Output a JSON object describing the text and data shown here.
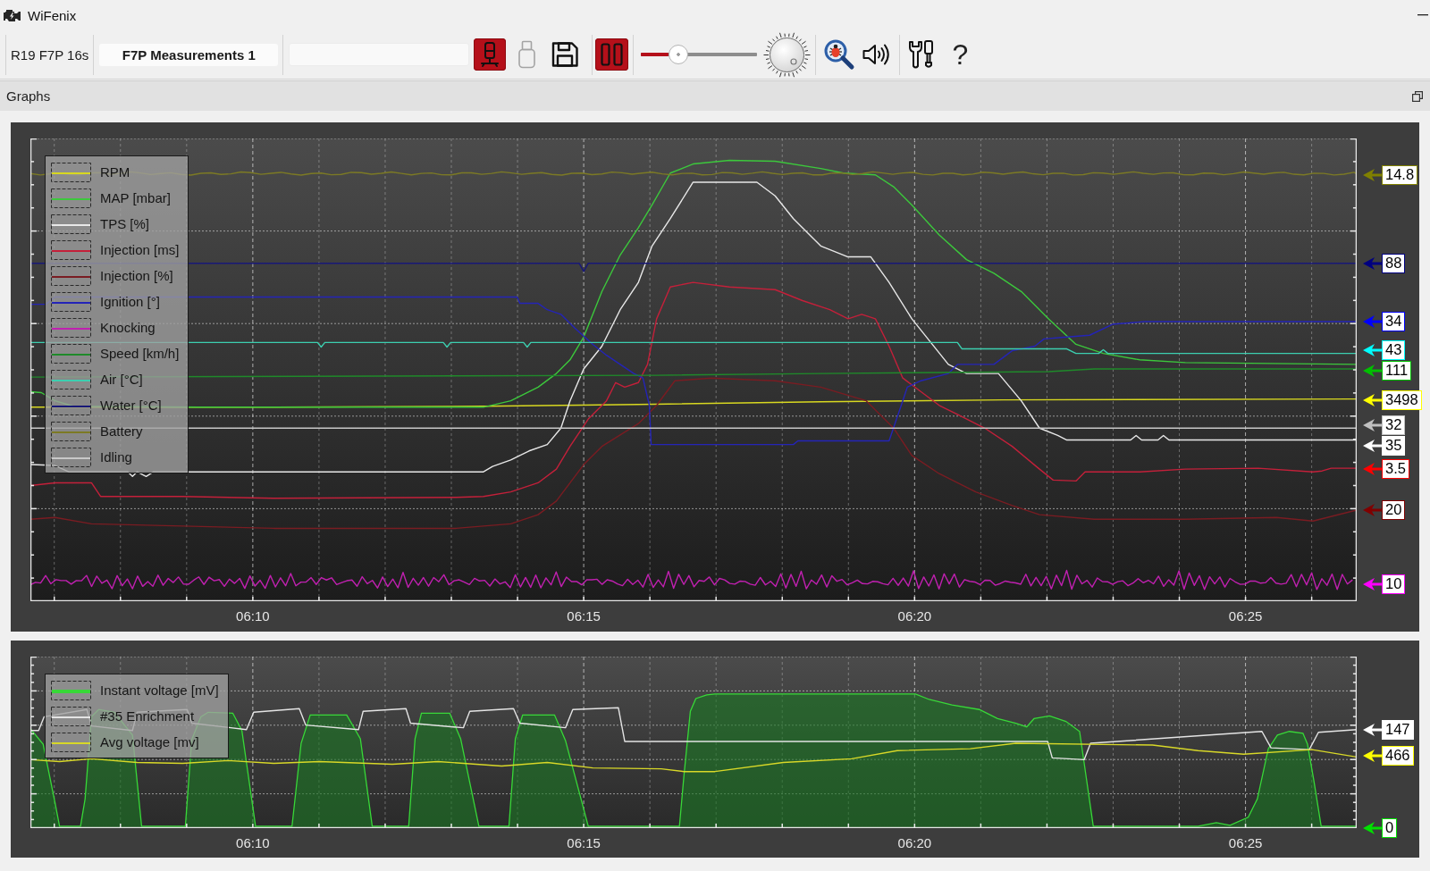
{
  "window": {
    "title": "WiFenix"
  },
  "toolbar": {
    "session_info": "R19 F7P 16s",
    "measurement_name": "F7P Measurements 1",
    "record_button": {
      "on": true
    },
    "usb_button": {
      "disabled": true
    },
    "save_button": {
      "disabled": false
    },
    "pause_button": {
      "on": true
    },
    "speed_slider": {
      "level": 0.32
    },
    "help_button": "?"
  },
  "panel": {
    "title": "Graphs"
  },
  "graphs": [
    {
      "legend": [
        {
          "label": "RPM",
          "color": "#d8d820"
        },
        {
          "label": "MAP [mbar]",
          "color": "#3cc83c"
        },
        {
          "label": "TPS [%]",
          "color": "#e8e8e8"
        },
        {
          "label": "Injection [ms]",
          "color": "#c4203a"
        },
        {
          "label": "Injection [%]",
          "color": "#7a1c22"
        },
        {
          "label": "Ignition [°]",
          "color": "#2424b8"
        },
        {
          "label": "Knocking",
          "color": "#c020b0"
        },
        {
          "label": "Speed [km/h]",
          "color": "#1f8a2a"
        },
        {
          "label": "Air [°C]",
          "color": "#3ccfb0"
        },
        {
          "label": "Water [°C]",
          "color": "#181878"
        },
        {
          "label": "Battery",
          "color": "#7c7a24"
        },
        {
          "label": "Idling",
          "color": "#c8c8c8"
        }
      ],
      "value_markers": [
        {
          "value": "14.8",
          "color": "#808000"
        },
        {
          "value": "88",
          "color": "#000080"
        },
        {
          "value": "34",
          "color": "#0000ff"
        },
        {
          "value": "43",
          "color": "#00ffff"
        },
        {
          "value": "111",
          "color": "#00c000"
        },
        {
          "value": "3498",
          "color": "#ffff00"
        },
        {
          "value": "32",
          "color": "#c0c0c0"
        },
        {
          "value": "35",
          "color": "#ffffff"
        },
        {
          "value": "3.5",
          "color": "#ff0000"
        },
        {
          "value": "20",
          "color": "#800000"
        },
        {
          "value": "10",
          "color": "#ff00ff"
        }
      ],
      "time_labels": [
        "06:10",
        "06:15",
        "06:20",
        "06:25"
      ]
    },
    {
      "legend": [
        {
          "label": "Instant voltage [mV]",
          "color": "#38d838",
          "kind": "area"
        },
        {
          "label": "#35 Enrichment",
          "color": "#e4e4e4",
          "kind": "line"
        },
        {
          "label": "Avg voltage [mv]",
          "color": "#d8d828",
          "kind": "line"
        }
      ],
      "value_markers": [
        {
          "value": "147",
          "color": "#ffffff"
        },
        {
          "value": "466",
          "color": "#ffff00"
        },
        {
          "value": "0",
          "color": "#00e000"
        }
      ],
      "time_labels": [
        "06:10",
        "06:15",
        "06:20",
        "06:25"
      ]
    }
  ]
}
